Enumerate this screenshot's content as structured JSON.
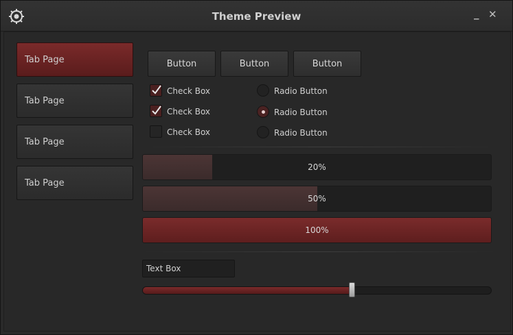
{
  "window": {
    "title": "Theme Preview",
    "min_glyph": "_",
    "close_glyph": "✕"
  },
  "tabs": [
    {
      "label": "Tab Page",
      "active": true
    },
    {
      "label": "Tab Page",
      "active": false
    },
    {
      "label": "Tab Page",
      "active": false
    },
    {
      "label": "Tab Page",
      "active": false
    }
  ],
  "buttons": [
    "Button",
    "Button",
    "Button"
  ],
  "checkboxes": [
    {
      "label": "Check Box",
      "checked": true
    },
    {
      "label": "Check Box",
      "checked": true
    },
    {
      "label": "Check Box",
      "checked": false
    }
  ],
  "radios": [
    {
      "label": "Radio Button",
      "selected": false
    },
    {
      "label": "Radio Button",
      "selected": true
    },
    {
      "label": "Radio Button",
      "selected": false
    }
  ],
  "progress": [
    {
      "label": "20%",
      "value": 0.2
    },
    {
      "label": "50%",
      "value": 0.5
    },
    {
      "label": "100%",
      "value": 1.0
    }
  ],
  "textbox": {
    "value": "Text Box"
  },
  "slider": {
    "value": 0.6
  },
  "colors": {
    "accent": "#7a2a2a",
    "background": "#282828"
  },
  "icons": {
    "app": "gear-logo-icon"
  }
}
